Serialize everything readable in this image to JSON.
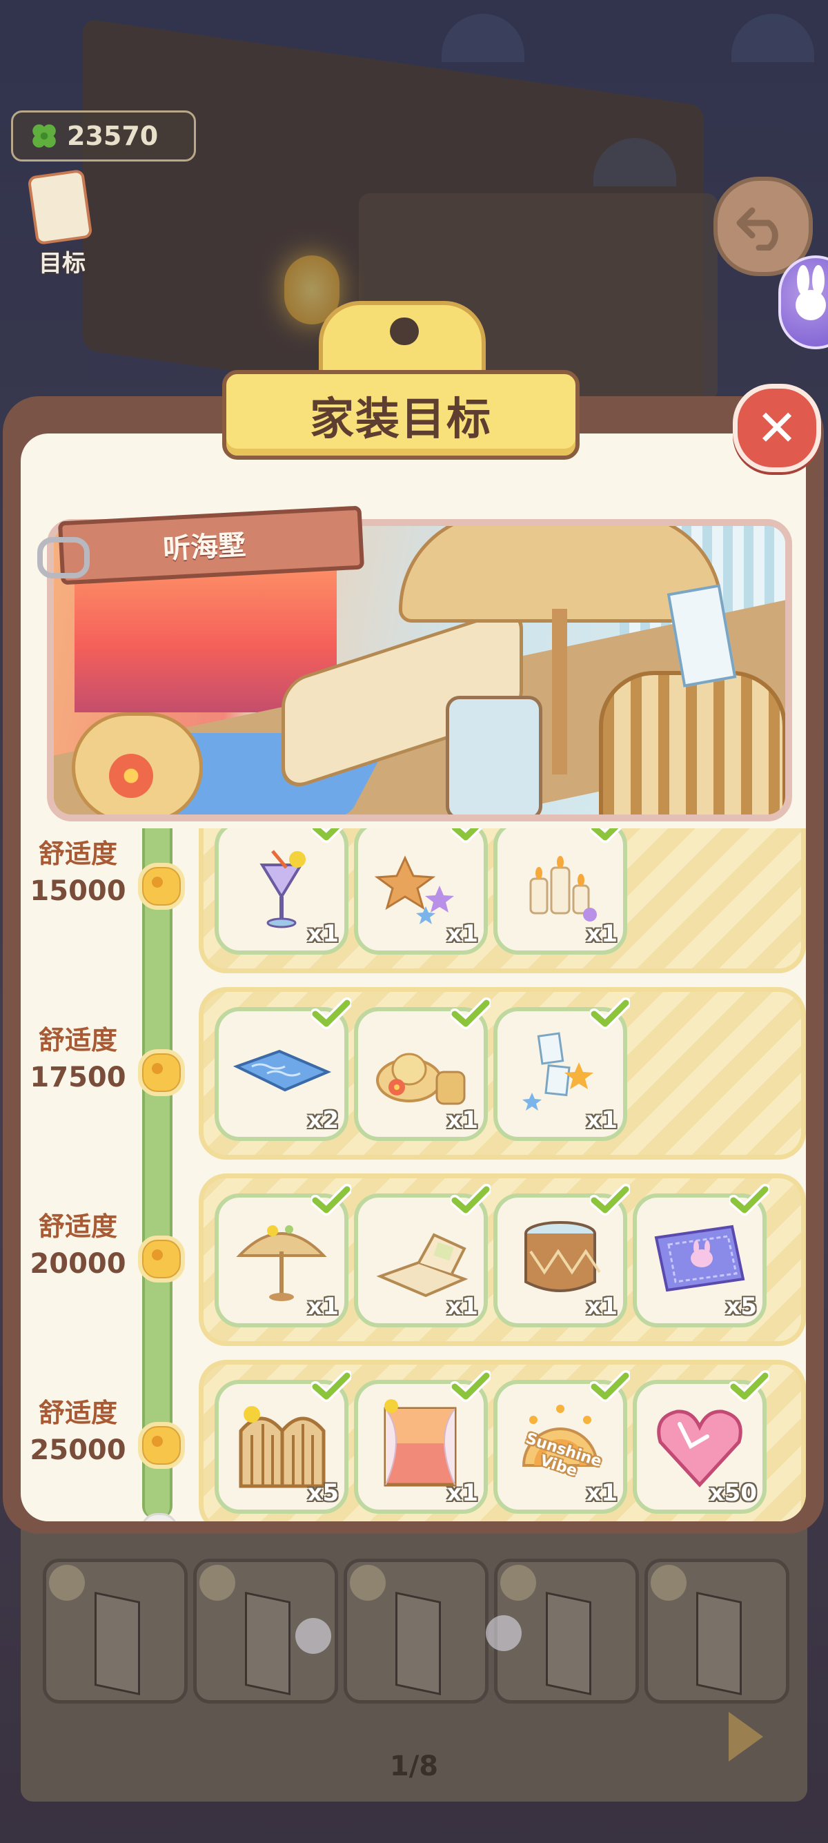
{
  "hud": {
    "currency_value": "23570",
    "goal_label": "目标"
  },
  "dialog": {
    "title": "家装目标",
    "banner_name": "听海墅"
  },
  "pager": {
    "page": "1/8"
  },
  "stages": [
    {
      "label": "舒适度",
      "value": "15000",
      "items": [
        {
          "icon": "cocktail-icon",
          "qty": "x1",
          "done": true
        },
        {
          "icon": "starfish-icon",
          "qty": "x1",
          "done": true
        },
        {
          "icon": "candles-icon",
          "qty": "x1",
          "done": true
        }
      ]
    },
    {
      "label": "舒适度",
      "value": "17500",
      "items": [
        {
          "icon": "pool-rug-icon",
          "qty": "x2",
          "done": true
        },
        {
          "icon": "sunhat-bag-icon",
          "qty": "x1",
          "done": true
        },
        {
          "icon": "photo-garland-icon",
          "qty": "x1",
          "done": true
        }
      ]
    },
    {
      "label": "舒适度",
      "value": "20000",
      "items": [
        {
          "icon": "beach-umbrella-icon",
          "qty": "x1",
          "done": true
        },
        {
          "icon": "lounge-chair-icon",
          "qty": "x1",
          "done": true
        },
        {
          "icon": "side-table-icon",
          "qty": "x1",
          "done": true
        },
        {
          "icon": "ticket-icon",
          "qty": "x5",
          "done": true
        }
      ]
    },
    {
      "label": "舒适度",
      "value": "25000",
      "items": [
        {
          "icon": "garden-gate-icon",
          "qty": "x5",
          "done": true
        },
        {
          "icon": "sunset-window-icon",
          "qty": "x1",
          "done": true
        },
        {
          "icon": "sunshine-vibe-sign-icon",
          "qty": "x1",
          "done": true,
          "sign_text": "Sunshine Vibe"
        },
        {
          "icon": "heart-gem-icon",
          "qty": "x50",
          "done": true
        }
      ]
    }
  ],
  "colors": {
    "rail": "#a6cd7e",
    "check": "#8cc43c",
    "label": "#a85a34",
    "close": "#e05a4e"
  }
}
